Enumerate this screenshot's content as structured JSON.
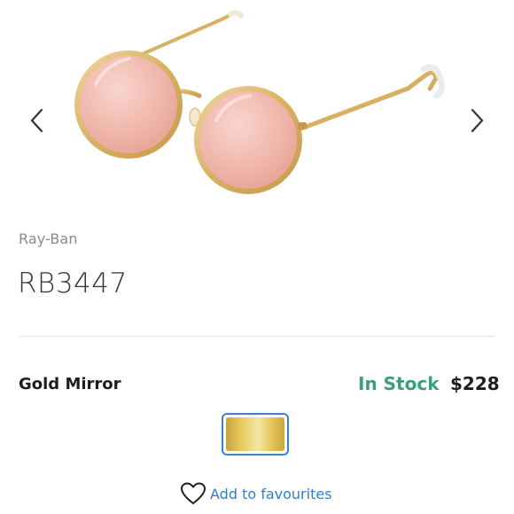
{
  "product": {
    "brand": "Ray-Ban",
    "model": "RB3447",
    "variant_name": "Gold Mirror",
    "stock_status": "In Stock",
    "price": "$228"
  },
  "gallery": {
    "prev_icon": "chevron-left-icon",
    "next_icon": "chevron-right-icon"
  },
  "swatch": {
    "selected": "Gold Mirror",
    "border_color": "#3b82d6"
  },
  "actions": {
    "favourite_label": "Add to favourites",
    "favourite_icon": "heart-outline-icon"
  },
  "colors": {
    "stock": "#3aa07b",
    "link": "#2f7fd0",
    "brand_text": "#8a8a8a"
  }
}
